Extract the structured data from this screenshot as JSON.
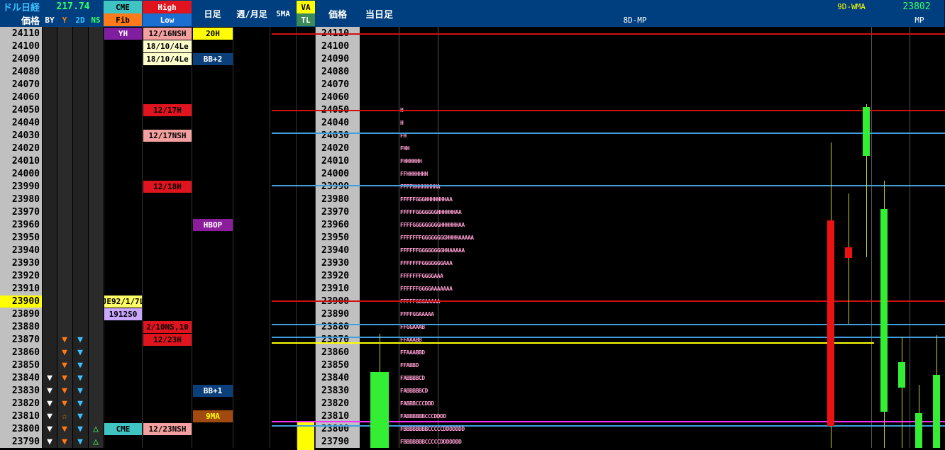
{
  "header": {
    "title": "ドル日経",
    "price_label": "価格",
    "ticker_value": "217.74",
    "flags": [
      "BY",
      "Y",
      "2D",
      "NS"
    ],
    "cme": "CME",
    "fib": "Fib",
    "high": "High",
    "low": "Low",
    "daily": "日足",
    "weekly_monthly": "週/月足",
    "ma5": "5MA",
    "va": "VA",
    "tl": "TL",
    "price_label2": "価格",
    "today": "当日足",
    "mp8d": "8D-MP",
    "wma9d": "9D-WMA",
    "last_value": "23802",
    "mp": "MP"
  },
  "prices": [
    "24110",
    "24100",
    "24090",
    "24080",
    "24070",
    "24060",
    "24050",
    "24040",
    "24030",
    "24020",
    "24010",
    "24000",
    "23990",
    "23980",
    "23970",
    "23960",
    "23950",
    "23940",
    "23930",
    "23920",
    "23910",
    "23900",
    "23890",
    "23880",
    "23870",
    "23860",
    "23850",
    "23840",
    "23830",
    "23820",
    "23810",
    "23800",
    "23790"
  ],
  "highlight_price": "23900",
  "cme_tags": [
    {
      "row": 0,
      "text": "YH",
      "bg": "#7f1fa0",
      "fg": "#fff"
    },
    {
      "row": 21,
      "text": "JE92/1/7L",
      "bg": "#ffff66",
      "fg": "#000"
    },
    {
      "row": 22,
      "text": "1912S0",
      "bg": "#c9a7ff",
      "fg": "#000"
    },
    {
      "row": 31,
      "text": "CME",
      "bg": "#3fc3c3",
      "fg": "#000"
    }
  ],
  "highlow_tags": [
    {
      "row": 0,
      "text": "12/16NSH",
      "bg": "#f4a0a0",
      "fg": "#000"
    },
    {
      "row": 1,
      "text": "18/10/4Le",
      "bg": "#ffffcc",
      "fg": "#000"
    },
    {
      "row": 2,
      "text": "18/10/4Le",
      "bg": "#ffffcc",
      "fg": "#000"
    },
    {
      "row": 6,
      "text": "12/17H",
      "bg": "#e0141e",
      "fg": "#000"
    },
    {
      "row": 8,
      "text": "12/17NSH",
      "bg": "#f4a0a0",
      "fg": "#000"
    },
    {
      "row": 12,
      "text": "12/18H",
      "bg": "#e0141e",
      "fg": "#000"
    },
    {
      "row": 23,
      "text": "2/10NS,10",
      "bg": "#e0141e",
      "fg": "#000"
    },
    {
      "row": 24,
      "text": "12/23H",
      "bg": "#e0141e",
      "fg": "#000"
    },
    {
      "row": 31,
      "text": "12/23NSH",
      "bg": "#f4a0a0",
      "fg": "#000"
    }
  ],
  "daily_tags": [
    {
      "row": 0,
      "text": "20H",
      "bg": "#ffff00",
      "fg": "#000"
    },
    {
      "row": 2,
      "text": "BB+2",
      "bg": "#0a3f7a",
      "fg": "#fff"
    },
    {
      "row": 15,
      "text": "HBOP",
      "bg": "#8a1e9a",
      "fg": "#fff"
    },
    {
      "row": 28,
      "text": "BB+1",
      "bg": "#0a3f7a",
      "fg": "#fff"
    },
    {
      "row": 30,
      "text": "9MA",
      "bg": "#a04a10",
      "fg": "#ffff00"
    }
  ],
  "signals": {
    "by": [
      27,
      28,
      29,
      30,
      31,
      32
    ],
    "y": [
      24,
      25,
      26,
      27,
      28,
      29,
      31,
      32
    ],
    "y_star": [
      30
    ],
    "d2": [
      24,
      25,
      26,
      27,
      28,
      29,
      30,
      31,
      32
    ],
    "ns": [
      31,
      32
    ]
  },
  "mp_rows": [
    {
      "row": 6,
      "text": "H"
    },
    {
      "row": 7,
      "text": "H"
    },
    {
      "row": 8,
      "text": "FH"
    },
    {
      "row": 9,
      "text": "FHH"
    },
    {
      "row": 10,
      "text": "FHHHHHH"
    },
    {
      "row": 11,
      "text": "FFHHHHHHH"
    },
    {
      "row": 12,
      "text": "FFFFHHHHHHHHA"
    },
    {
      "row": 13,
      "text": "FFFFFGGGHHHHHHHAA"
    },
    {
      "row": 14,
      "text": "FFFFFGGGGGGGHHHHHHAA"
    },
    {
      "row": 15,
      "text": "FFFFGGGGGGGGGHHHHHHAA"
    },
    {
      "row": 16,
      "text": "FFFFFFFGGGGGGGGHHHHAAAAA"
    },
    {
      "row": 17,
      "text": "FFFFFFGGGGGGGGHHAAAAA"
    },
    {
      "row": 18,
      "text": "FFFFFFFGGGGGGGAAA"
    },
    {
      "row": 19,
      "text": "FFFFFFFGGGGAAA"
    },
    {
      "row": 20,
      "text": "FFFFFFGGGGAAAAAAA"
    },
    {
      "row": 21,
      "text": "FFFFFGGGAAAAA"
    },
    {
      "row": 22,
      "text": "FFFFGGAAAAA"
    },
    {
      "row": 23,
      "text": "FFGGAAAB"
    },
    {
      "row": 24,
      "text": "FFAAABB"
    },
    {
      "row": 25,
      "text": "FFAAABBD"
    },
    {
      "row": 26,
      "text": "FFABBD"
    },
    {
      "row": 27,
      "text": "FABBBBCD"
    },
    {
      "row": 28,
      "text": "FABBBBBCD"
    },
    {
      "row": 29,
      "text": "FABBBCCCDDD"
    },
    {
      "row": 30,
      "text": "FABBBBBBCCCDDDD"
    },
    {
      "row": 31,
      "text": "FBBBBBBBBCCCCCDDDDDDD"
    },
    {
      "row": 32,
      "text": "FBBBBBBBCCCCCDDDDDDD"
    }
  ],
  "colors": {
    "header_bg": "#003f7f",
    "price_bg": "#c0c0c0",
    "bull": "#33ee33",
    "bear": "#ee1111",
    "red_line": "#d01010",
    "blue_line": "#3fa0e0",
    "yellow_line": "#ffff00",
    "magenta_line": "#ff30ff"
  }
}
